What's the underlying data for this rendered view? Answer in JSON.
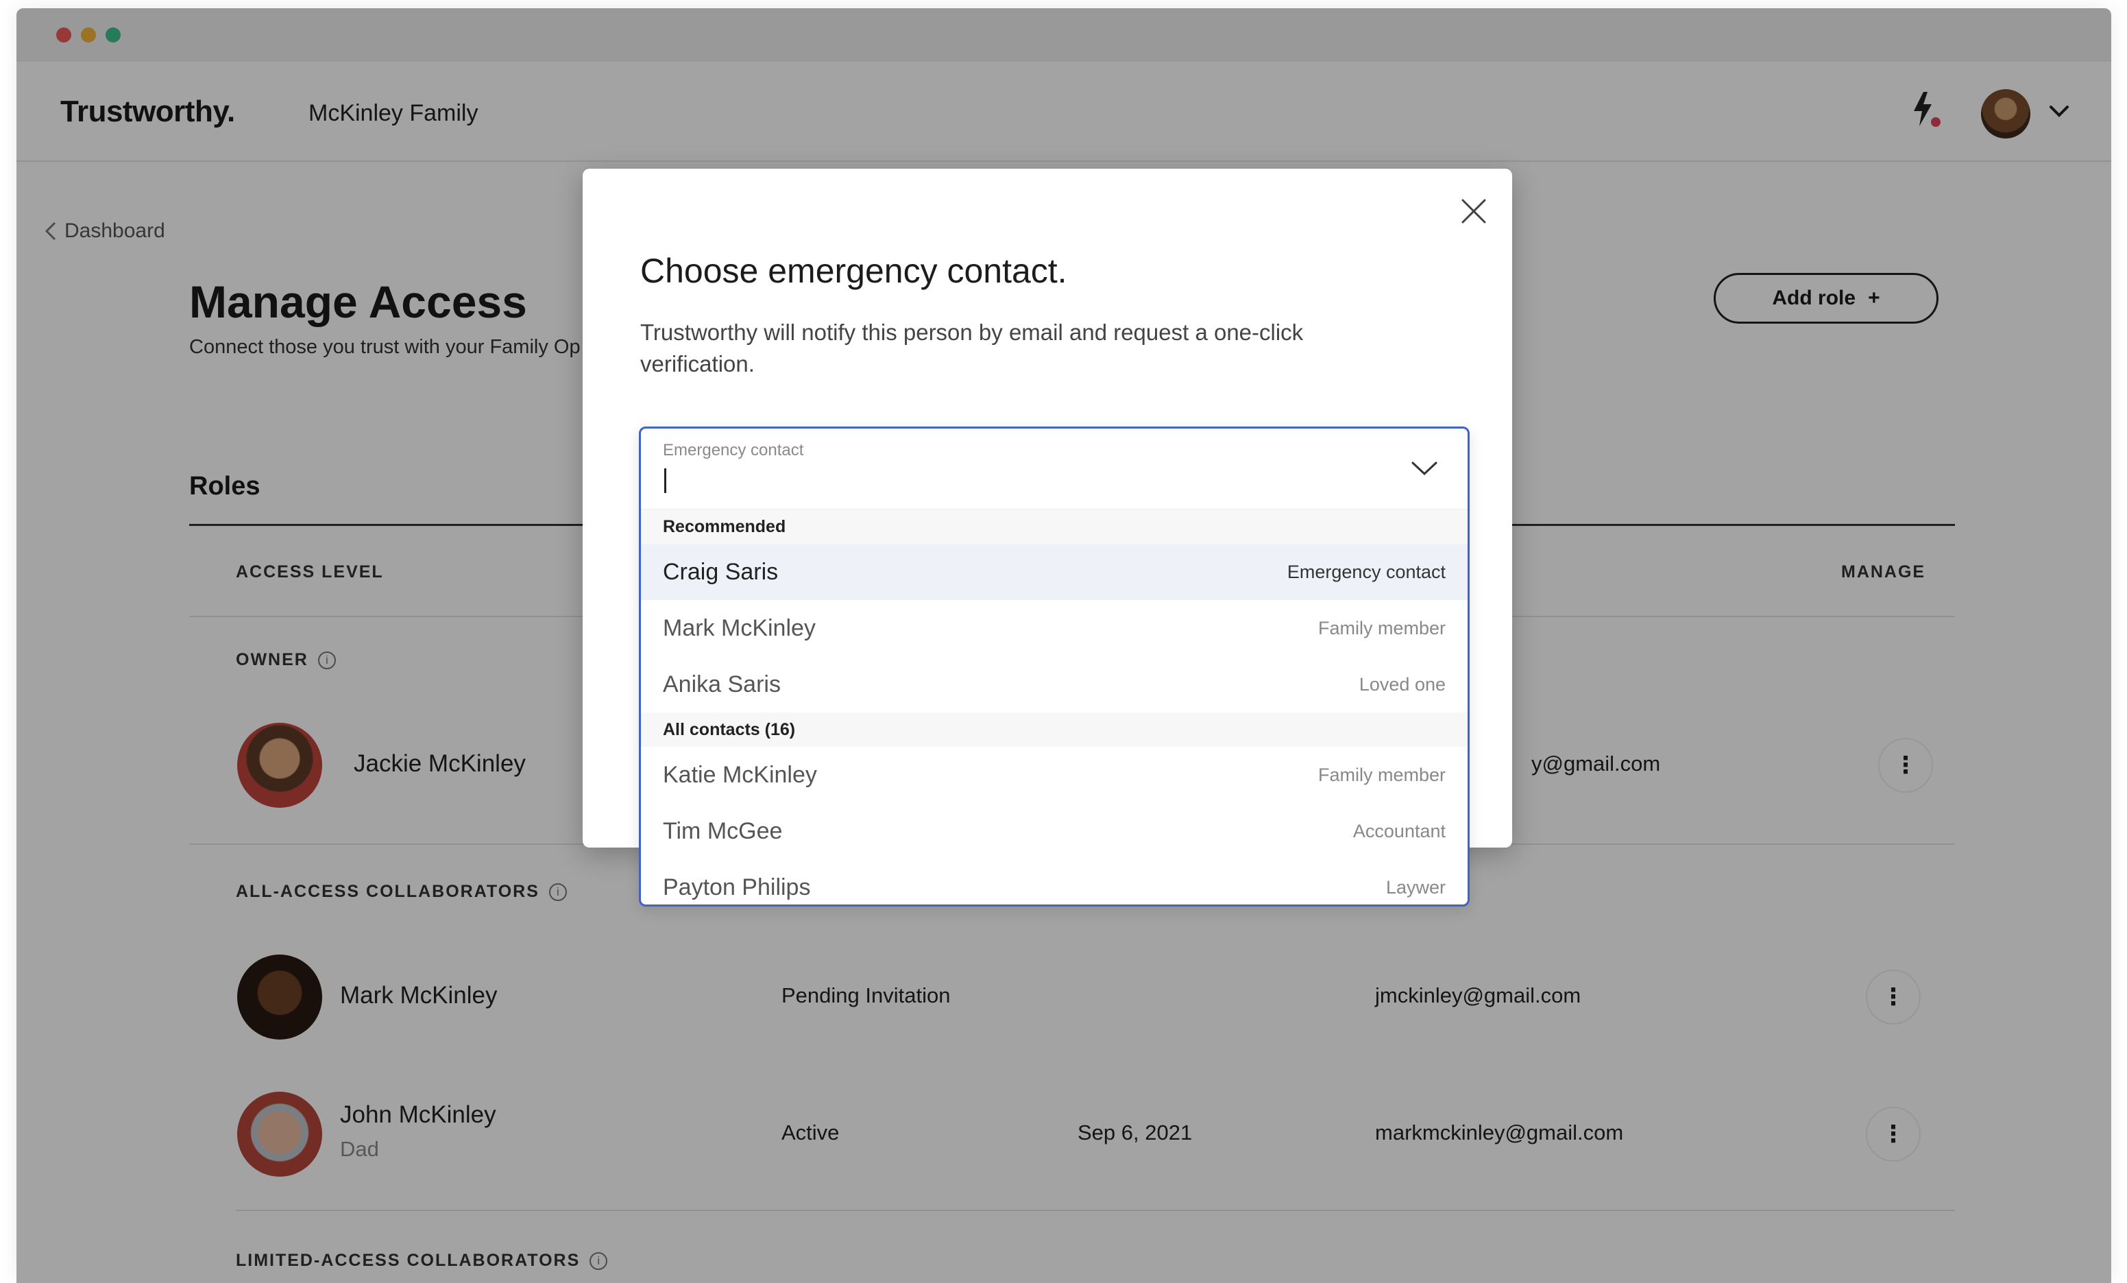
{
  "window": {
    "traffic_lights": [
      "#ed5a5a",
      "#f2b53a",
      "#3fc08e"
    ]
  },
  "app": {
    "logo": "Trustworthy.",
    "family_name": "McKinley Family",
    "notification_icon": "bolt-icon",
    "accent_color": "#e0455a"
  },
  "page": {
    "back_label": "Dashboard",
    "title": "Manage Access",
    "subtitle": "Connect those you trust with your Family Op",
    "add_role_label": "Add role",
    "add_role_icon": "+",
    "roles_heading": "Roles"
  },
  "table": {
    "headers": {
      "access_level": "ACCESS LEVEL",
      "manage": "MANAGE"
    },
    "sections": {
      "owner": "OWNER",
      "all_access": "ALL-ACCESS COLLABORATORS",
      "limited_access": "LIMITED-ACCESS COLLABORATORS"
    },
    "owner": {
      "name": "Jackie McKinley",
      "email_partial": "y@gmail.com"
    },
    "collaborators": [
      {
        "name": "Mark McKinley",
        "relation": "",
        "status": "Pending Invitation",
        "date": "",
        "email": "jmckinley@gmail.com"
      },
      {
        "name": "John McKinley",
        "relation": "Dad",
        "status": "Active",
        "date": "Sep 6, 2021",
        "email": "markmckinley@gmail.com"
      }
    ]
  },
  "modal": {
    "title": "Choose emergency contact.",
    "description": "Trustworthy will notify this person by email and request a one-click verification.",
    "field_label": "Emergency contact",
    "field_value": "",
    "recommended_label": "Recommended",
    "recommended": [
      {
        "name": "Craig Saris",
        "role": "Emergency contact"
      },
      {
        "name": "Mark McKinley",
        "role": "Family member"
      },
      {
        "name": "Anika Saris",
        "role": "Loved one"
      }
    ],
    "all_contacts_label": "All contacts (16)",
    "all_contacts": [
      {
        "name": "Katie McKinley",
        "role": "Family member"
      },
      {
        "name": "Tim McGee",
        "role": "Accountant"
      },
      {
        "name": "Payton Philips",
        "role": "Laywer"
      }
    ]
  }
}
